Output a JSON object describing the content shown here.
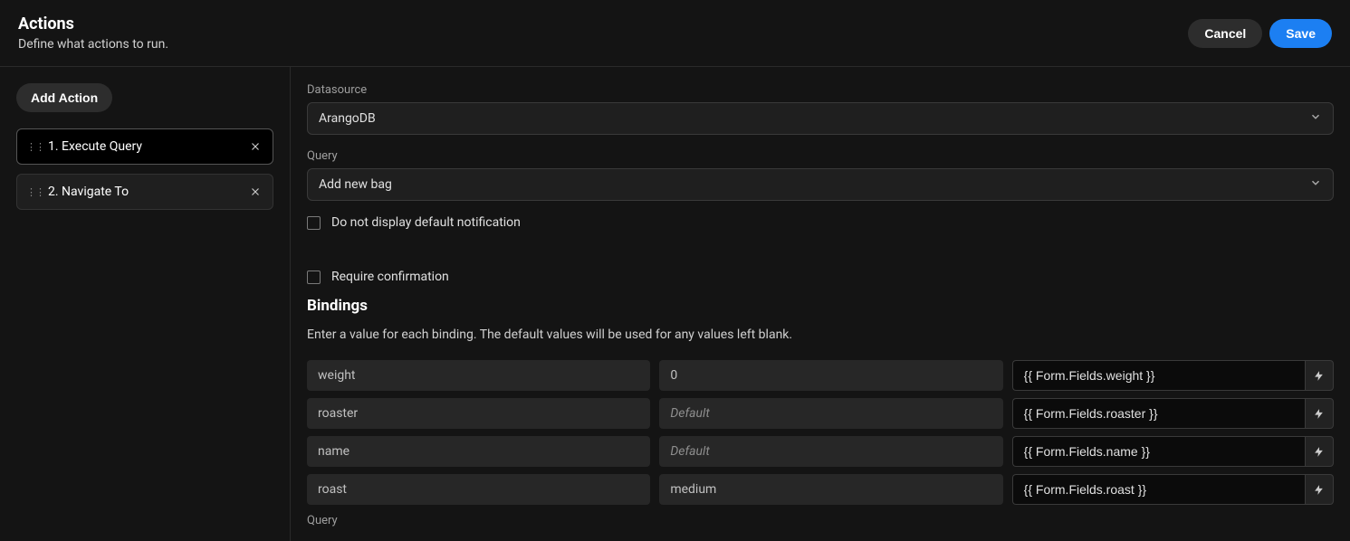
{
  "header": {
    "title": "Actions",
    "subtitle": "Define what actions to run.",
    "cancel_label": "Cancel",
    "save_label": "Save"
  },
  "sidebar": {
    "add_action_label": "Add Action",
    "items": [
      {
        "label": "1. Execute Query",
        "active": true
      },
      {
        "label": "2. Navigate To",
        "active": false
      }
    ]
  },
  "main": {
    "datasource_label": "Datasource",
    "datasource_value": "ArangoDB",
    "query_label": "Query",
    "query_value": "Add new bag",
    "checkbox_no_notif": "Do not display default notification",
    "checkbox_confirm": "Require confirmation",
    "bindings_title": "Bindings",
    "bindings_desc": "Enter a value for each binding. The default values will be used for any values left blank.",
    "bindings": [
      {
        "name": "weight",
        "default": "0",
        "default_is_placeholder": false,
        "value": "{{ Form.Fields.weight }}"
      },
      {
        "name": "roaster",
        "default": "Default",
        "default_is_placeholder": true,
        "value": "{{ Form.Fields.roaster }}"
      },
      {
        "name": "name",
        "default": "Default",
        "default_is_placeholder": true,
        "value": "{{ Form.Fields.name }}"
      },
      {
        "name": "roast",
        "default": "medium",
        "default_is_placeholder": false,
        "value": "{{ Form.Fields.roast }}"
      }
    ],
    "bottom_query_label": "Query"
  }
}
